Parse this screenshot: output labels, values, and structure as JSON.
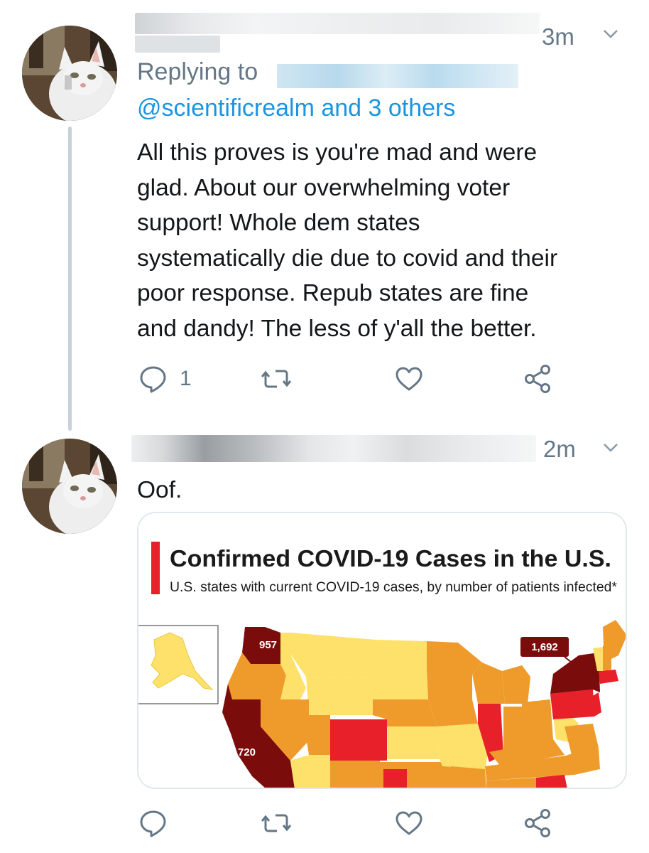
{
  "tweets": [
    {
      "time": "3m",
      "replying_prefix": "Replying to",
      "mentions": "@scientificrealm and 3 others",
      "body_lines": [
        "All this proves is you're mad and were",
        "glad. About our overwhelming voter",
        "support! Whole dem states",
        "systematically die due to covid and their",
        "poor response. Repub states are fine",
        "and dandy! The less of y'all the better."
      ],
      "reply_count": "1"
    },
    {
      "time": "2m",
      "body": "Oof.",
      "card": {
        "title": "Confirmed COVID-19 Cases in the U.S.",
        "subtitle": "U.S. states with current COVID-19 cases, by number of patients infected*",
        "labels": {
          "washington": "957",
          "new_york": "1,692",
          "california": "720"
        },
        "colors": {
          "dark_red": "#7a0c0c",
          "red": "#e8202a",
          "orange": "#ef9b2c",
          "yellow": "#fde16a",
          "accent_bar": "#e8202a"
        }
      }
    }
  ],
  "colors": {
    "muted": "#657786",
    "link": "#1b95e0",
    "thread_line": "#c9d1d8",
    "card_border": "#e1e8ed"
  },
  "icons": [
    "reply-icon",
    "retweet-icon",
    "like-icon",
    "share-icon",
    "chevron-down-icon"
  ]
}
